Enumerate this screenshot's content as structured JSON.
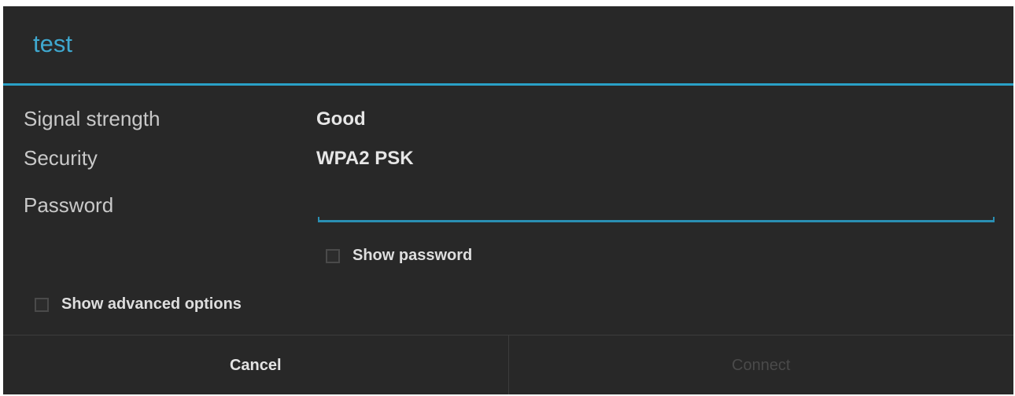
{
  "dialog": {
    "title": "test",
    "signal": {
      "label": "Signal strength",
      "value": "Good"
    },
    "security": {
      "label": "Security",
      "value": "WPA2 PSK"
    },
    "password": {
      "label": "Password",
      "value": ""
    },
    "show_password_label": "Show password",
    "show_advanced_label": "Show advanced options",
    "buttons": {
      "cancel": "Cancel",
      "connect": "Connect"
    }
  },
  "colors": {
    "accent": "#2aa0c7",
    "background": "#282828",
    "disabled_text": "#4a4a4a"
  }
}
